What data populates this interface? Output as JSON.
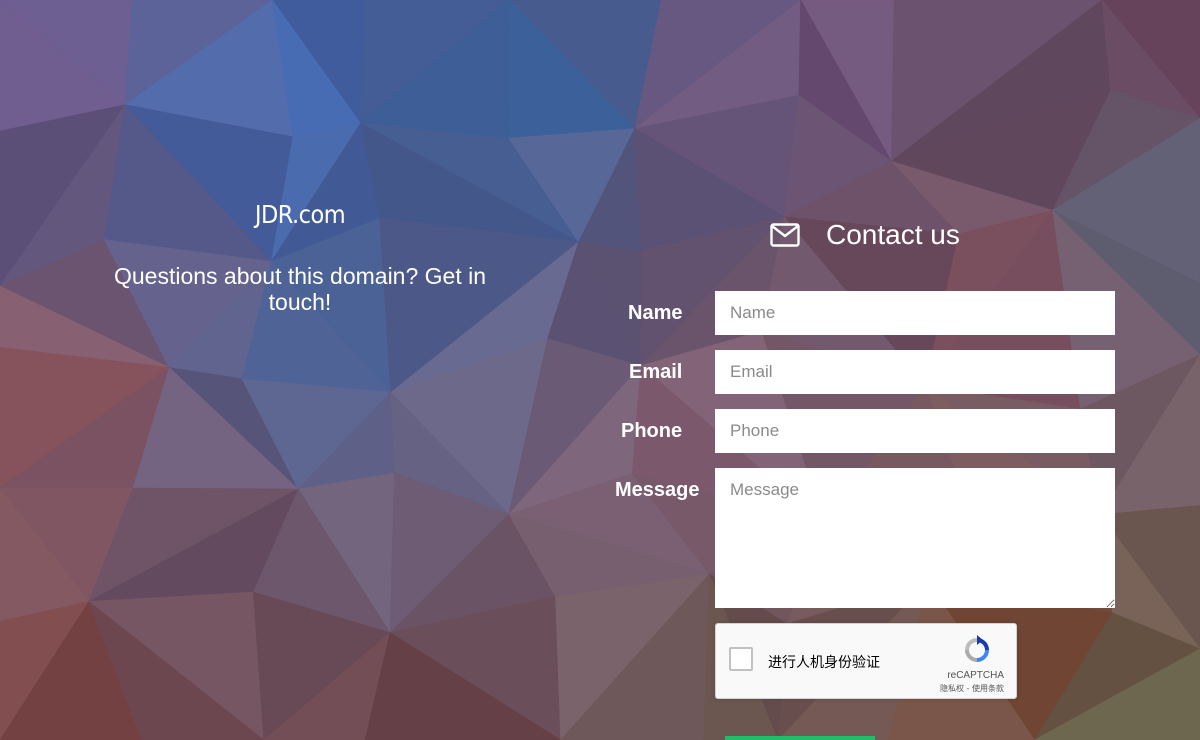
{
  "colors": {
    "background_palette": [
      "#6e5a86",
      "#3f64ad",
      "#4a6fa8",
      "#7a5a7a",
      "#8a4a4a",
      "#6e5a3e",
      "#5c6a5a"
    ],
    "submit_green": "#1ebe6a",
    "text_white": "#ffffff"
  },
  "brand": {
    "domain": "JDR.com",
    "tagline": "Questions about this domain? Get in touch!"
  },
  "contact": {
    "heading": "Contact us",
    "icon": "envelope-icon"
  },
  "form": {
    "name": {
      "label": "Name",
      "placeholder": "Name"
    },
    "email": {
      "label": "Email",
      "placeholder": "Email"
    },
    "phone": {
      "label": "Phone",
      "placeholder": "Phone"
    },
    "message": {
      "label": "Message",
      "placeholder": "Message"
    }
  },
  "recaptcha": {
    "checkbox_label": "进行人机身份验证",
    "brand": "reCAPTCHA",
    "links": "隐私权 - 使用条款",
    "icon": "recaptcha-logo-icon"
  }
}
